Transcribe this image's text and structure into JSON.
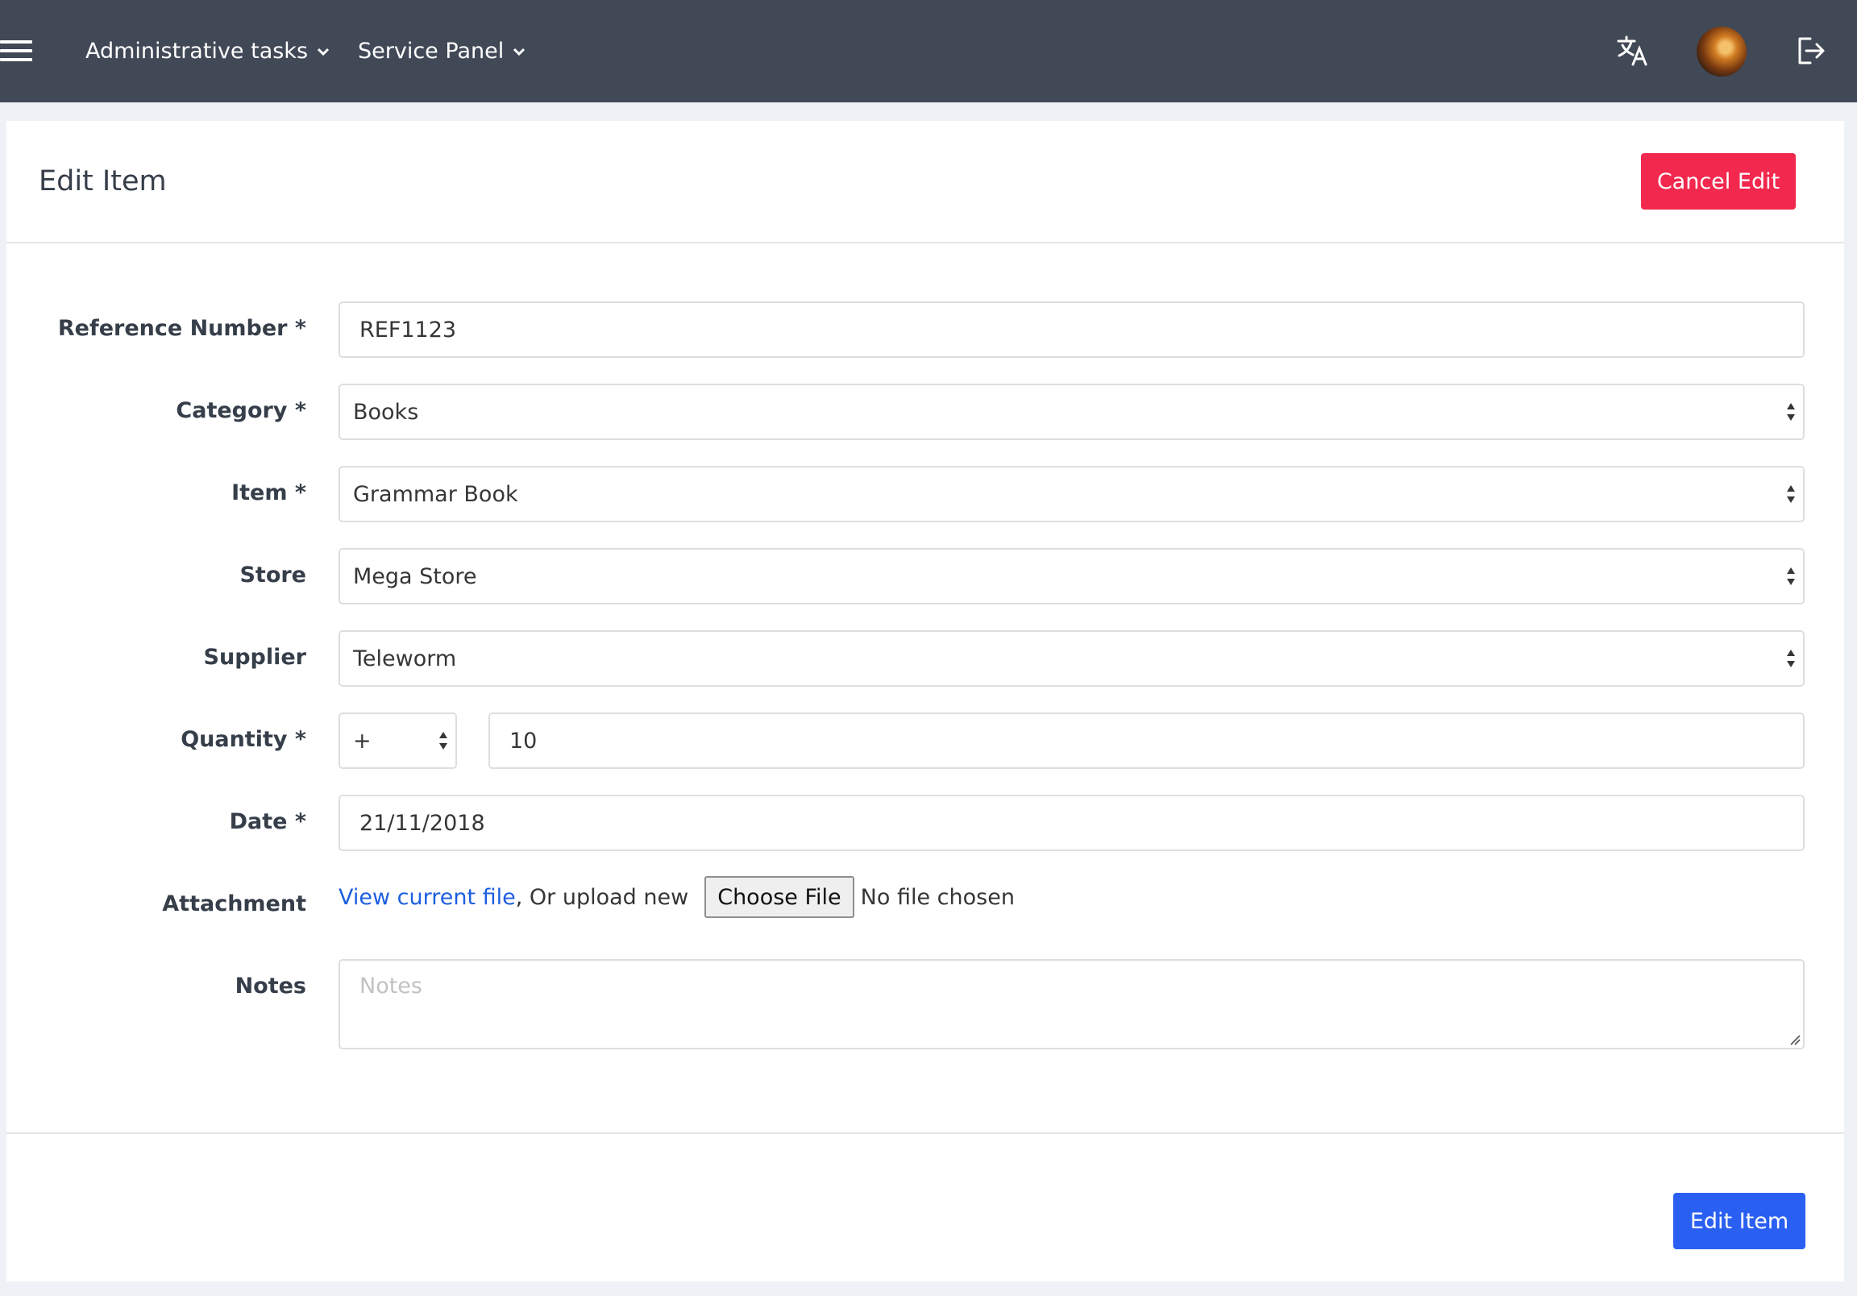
{
  "nav": {
    "menus": [
      "Administrative tasks",
      "Service Panel"
    ]
  },
  "page": {
    "title": "Edit Item",
    "cancel_label": "Cancel Edit",
    "submit_label": "Edit Item"
  },
  "form": {
    "reference": {
      "label": "Reference Number *",
      "value": "REF1123"
    },
    "category": {
      "label": "Category *",
      "value": "Books"
    },
    "item": {
      "label": "Item *",
      "value": "Grammar Book"
    },
    "store": {
      "label": "Store",
      "value": "Mega Store"
    },
    "supplier": {
      "label": "Supplier",
      "value": "Teleworm"
    },
    "quantity": {
      "label": "Quantity *",
      "sign": "+",
      "value": "10"
    },
    "date": {
      "label": "Date *",
      "value": "21/11/2018"
    },
    "attachment": {
      "label": "Attachment",
      "link": "View current file",
      "text": ", Or upload new",
      "choose_label": "Choose File",
      "status": "No file chosen"
    },
    "notes": {
      "label": "Notes",
      "placeholder": "Notes"
    }
  },
  "colors": {
    "navbar": "#414856",
    "cancel": "#f2284e",
    "submit": "#2a60f2",
    "link": "#1d5fe0"
  },
  "icons": {
    "menu": "hamburger-icon",
    "translate": "translate-icon",
    "avatar": "user-avatar",
    "logout": "logout-icon"
  }
}
